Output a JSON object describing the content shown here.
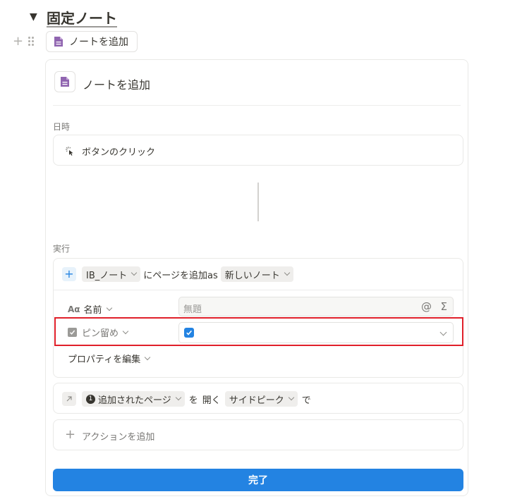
{
  "section": {
    "toggle_icon": "triangle-down-icon",
    "title": "固定ノート"
  },
  "button_block": {
    "label": "ノートを追加",
    "icon": "page-icon"
  },
  "panel": {
    "title": "ノートを追加",
    "trigger_label": "日時",
    "trigger_value": "ボタンのクリック",
    "action_label": "実行",
    "add_page_action": {
      "database": "IB_ノート",
      "connector_text": "にページを追加as",
      "template": "新しいノート",
      "properties": [
        {
          "icon": "Aα",
          "name": "名前",
          "placeholder": "無題",
          "mention_icon": "@",
          "formula_icon": "Σ"
        },
        {
          "icon": "checkbox-icon",
          "name": "ピン留め",
          "checked": true
        }
      ],
      "edit_properties": "プロパティを編集"
    },
    "open_page_action": {
      "step_number": "1",
      "page": "追加されたページ",
      "particle": "を",
      "verb": "開く",
      "mode": "サイドピーク",
      "suffix": "で"
    },
    "add_action_label": "アクションを追加",
    "done_button": "完了"
  },
  "colors": {
    "accent": "#2383e2",
    "page_icon": "#9065b0",
    "highlight": "#e0202a"
  }
}
